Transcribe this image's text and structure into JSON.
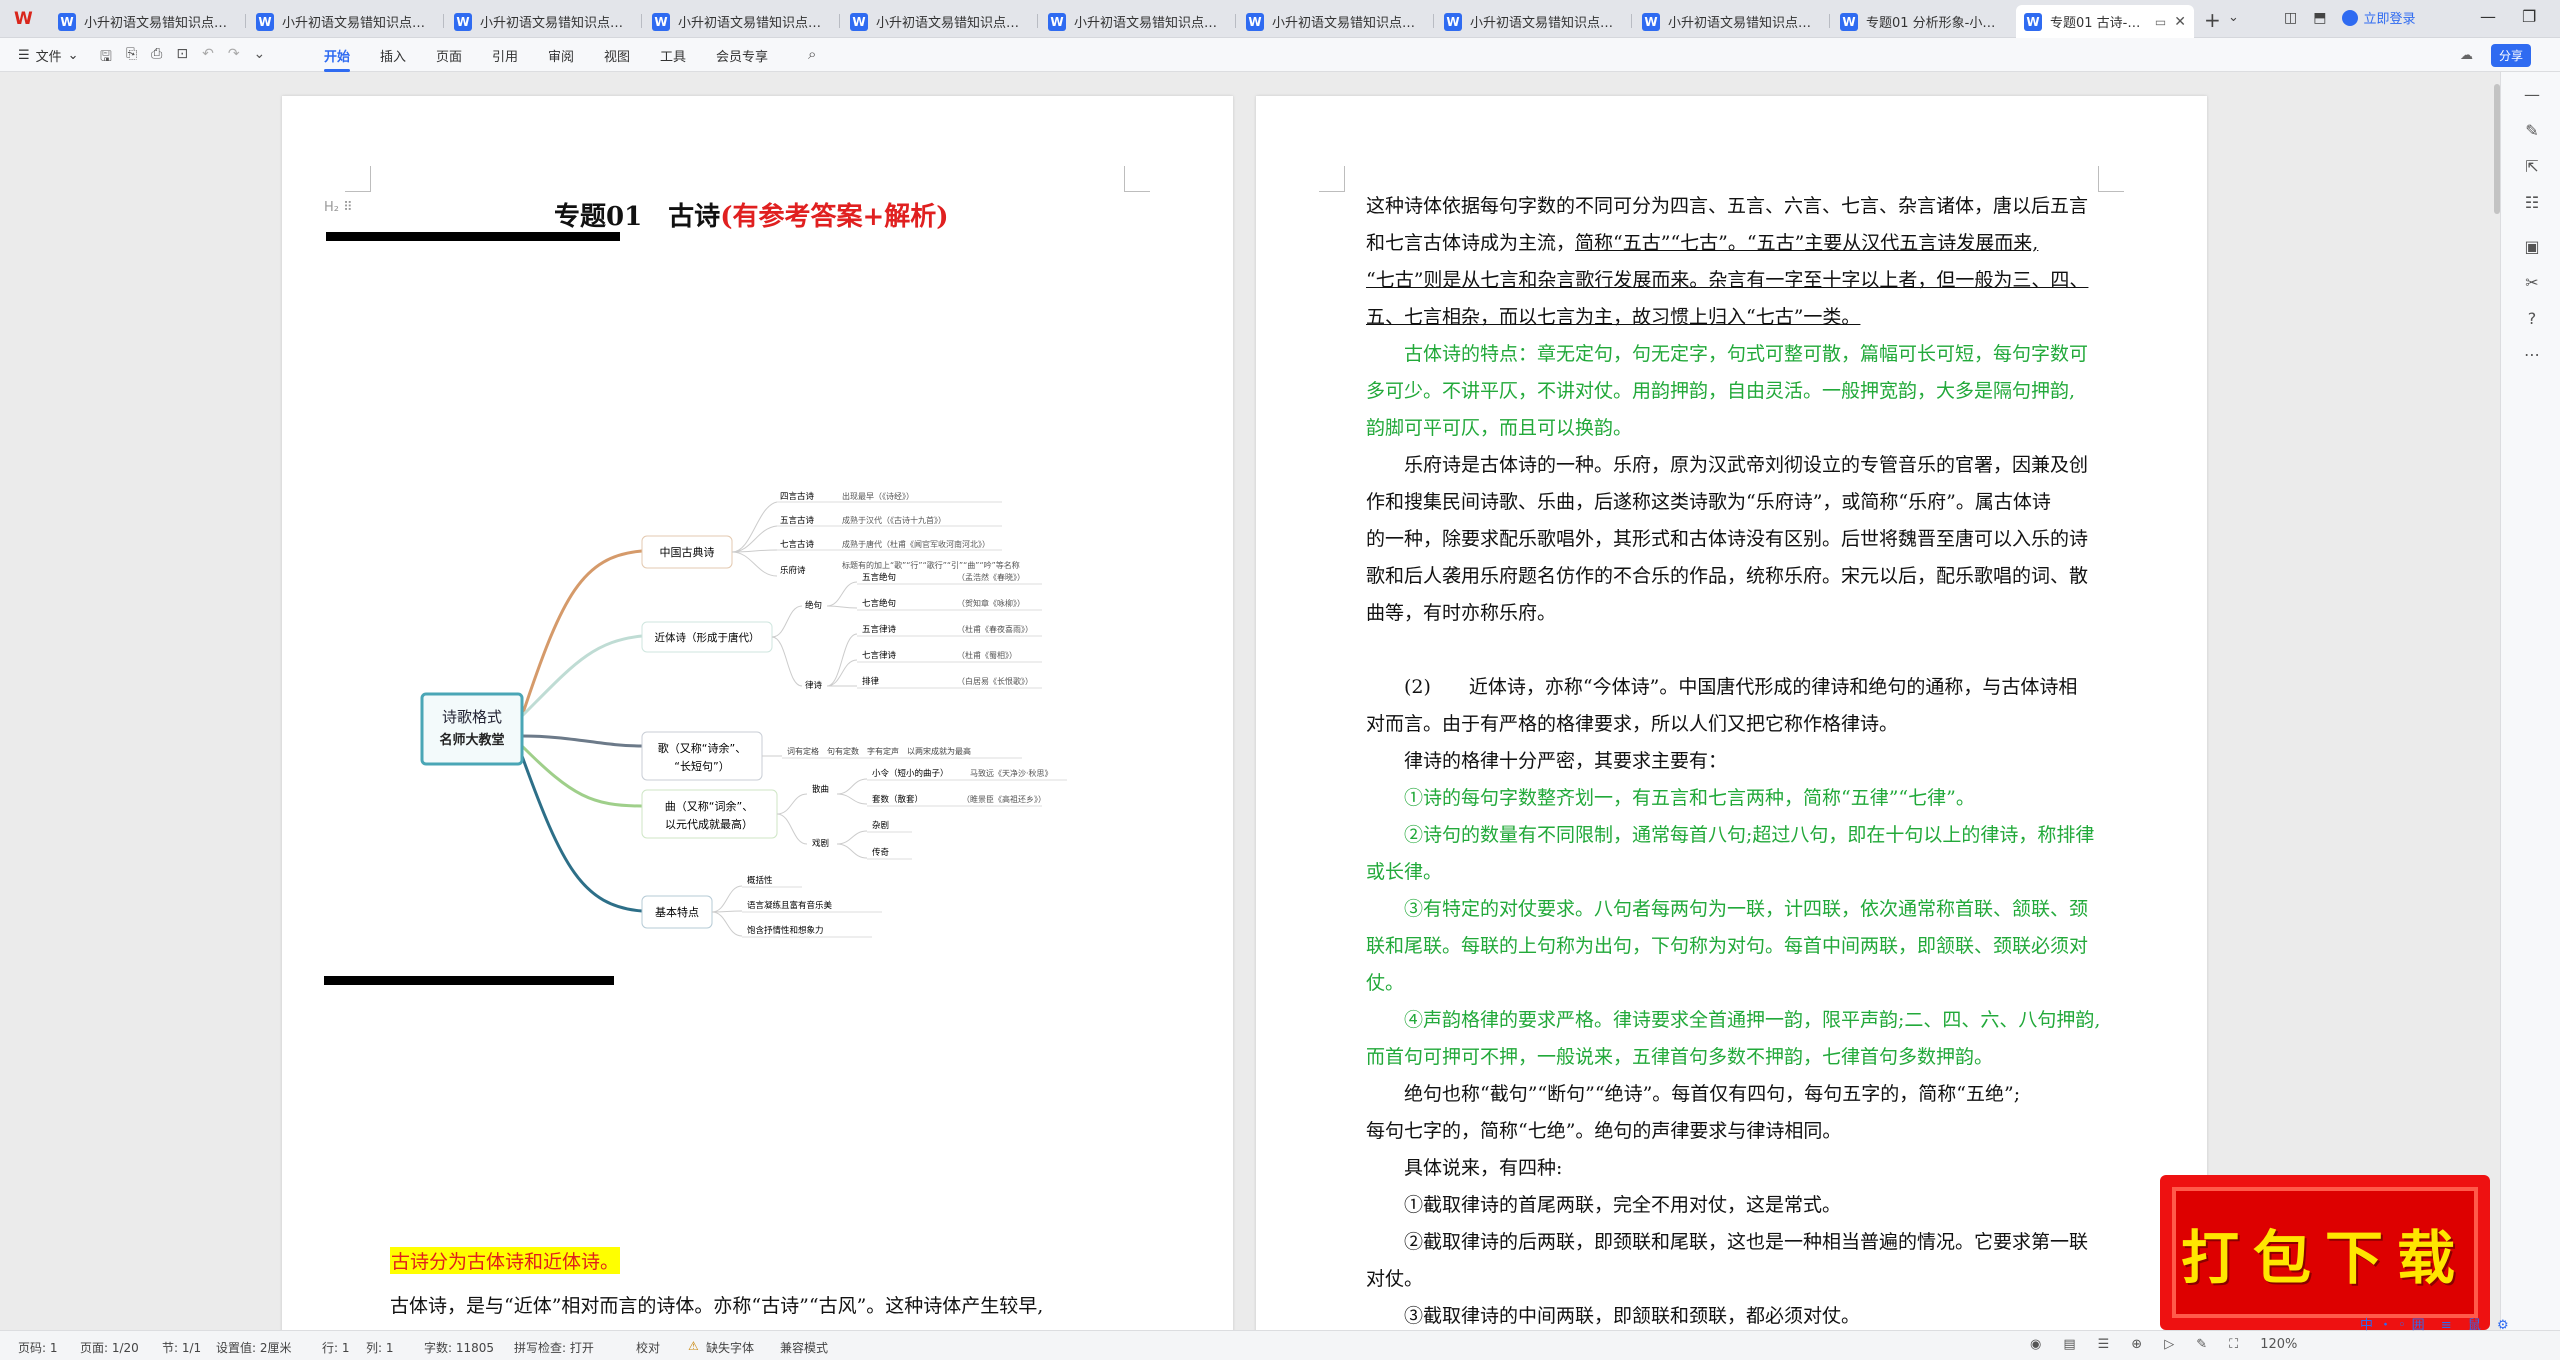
{
  "tabs": [
    {
      "label": "小升初语文易错知识点专项练"
    },
    {
      "label": "小升初语文易错知识点专项练"
    },
    {
      "label": "小升初语文易错知识点专项练"
    },
    {
      "label": "小升初语文易错知识点专项练"
    },
    {
      "label": "小升初语文易错知识点专项练"
    },
    {
      "label": "小升初语文易错知识点专项练"
    },
    {
      "label": "小升初语文易错知识点专项练"
    },
    {
      "label": "小升初语文易错知识点专项练"
    },
    {
      "label": "小升初语文易错知识点专项练"
    },
    {
      "label": "专题01 分析形象-小升初语文"
    },
    {
      "label": "专题01 古诗-小升初语"
    }
  ],
  "header": {
    "login": "立即登录",
    "share": "分享"
  },
  "ribbon": {
    "file": "文件",
    "tabs": [
      "开始",
      "插入",
      "页面",
      "引用",
      "审阅",
      "视图",
      "工具",
      "会员专享"
    ]
  },
  "page1": {
    "title_main": "专题01　古诗",
    "title_red": "(有参考答案+解析)",
    "mindmap": {
      "center_1": "诗歌格式",
      "center_2": "名师大教堂",
      "b1": "中国古典诗",
      "b1_items": [
        "四言古诗",
        "五言古诗",
        "七言古诗",
        "乐府诗"
      ],
      "b1_notes": [
        "出现最早（《诗经》）",
        "成熟于汉代（《古诗十九首》）",
        "成熟于唐代（杜甫《闻官军收河南河北》）",
        "标题有的加上“歌”“行”“歌行”“引”“曲”“吟”等名称"
      ],
      "b2": "近体诗（形成于唐代）",
      "b2_groups": [
        "绝句",
        "律诗"
      ],
      "b2_items": [
        "五言绝句",
        "七言绝句",
        "五言律诗",
        "七言律诗",
        "排律"
      ],
      "b2_notes": [
        "（孟浩然《春晓》）",
        "（贺知章《咏柳》）",
        "（杜甫《春夜喜雨》）",
        "（杜甫《蜀相》）",
        "（白居易《长恨歌》）"
      ],
      "b3_1": "歌（又称“诗余”、",
      "b3_2": "“长短句”）",
      "b3_note": "词有定格　句有定数　字有定声　以两宋成就为最高",
      "b4_1": "曲（又称“词余”、",
      "b4_2": "以元代成就最高）",
      "b4_groups": [
        "散曲",
        "戏剧"
      ],
      "b4_items": [
        "小令（短小的曲子）",
        "套数（散套）",
        "杂剧",
        "传奇"
      ],
      "b4_notes": [
        "马致远《天净沙·秋思》",
        "（睢景臣《高祖还乡》）"
      ],
      "b5": "基本特点",
      "b5_items": [
        "概括性",
        "语言凝练且富有音乐美",
        "饱含抒情性和想象力"
      ]
    },
    "highlight": "古诗分为古体诗和近体诗。",
    "body": "古体诗，是与“近体”相对而言的诗体。亦称“古诗”“古风”。这种诗体产生较早,"
  },
  "page2": {
    "lines": [
      {
        "t": "这种诗体依据每句字数的不同可分为四言、五言、六言、七言、杂言诸体，唐以后五言",
        "c": ""
      },
      {
        "t": "和七言古体诗成为主流，",
        "u": "简称“五古”“七古”。“五古”主要从汉代五言诗发展而来,",
        "c": ""
      },
      {
        "t": "",
        "u": "“七古”则是从七言和杂言歌行发展而来。杂言有一字至十字以上者，但一般为三、四、",
        "c": ""
      },
      {
        "t": "",
        "u": "五、七言相杂，而以七言为主，故习惯上归入“七古”一类。",
        "c": ""
      },
      {
        "t": "古体诗的特点：章无定句，句无定字，句式可整可散，篇幅可长可短，每句字数可",
        "c": "green",
        "ind": true
      },
      {
        "t": "多可少。不讲平仄，不讲对仗。用韵押韵，自由灵活。一般押宽韵，大多是隔句押韵,",
        "c": "green"
      },
      {
        "t": "韵脚可平可仄，而且可以换韵。",
        "c": "green"
      },
      {
        "t": "乐府诗是古体诗的一种。乐府，原为汉武帝刘彻设立的专管音乐的官署，因兼及创",
        "c": "",
        "ind": true
      },
      {
        "t": "作和搜集民间诗歌、乐曲，后遂称这类诗歌为“乐府诗”，或简称“乐府”。属古体诗",
        "c": ""
      },
      {
        "t": "的一种，除要求配乐歌唱外，其形式和古体诗没有区别。后世将魏晋至唐可以入乐的诗",
        "c": ""
      },
      {
        "t": "歌和后人袭用乐府题名仿作的不合乐的作品，统称乐府。宋元以后，配乐歌唱的词、散",
        "c": ""
      },
      {
        "t": "曲等，有时亦称乐府。",
        "c": ""
      },
      {
        "t": "",
        "c": "gap"
      },
      {
        "t": "(2)　　近体诗，亦称“今体诗”。中国唐代形成的律诗和绝句的通称，与古体诗相",
        "c": "",
        "ind": true
      },
      {
        "t": "对而言。由于有严格的格律要求，所以人们又把它称作格律诗。",
        "c": ""
      },
      {
        "t": "律诗的格律十分严密，其要求主要有：",
        "c": "",
        "ind": true
      },
      {
        "t": "①诗的每句字数整齐划一，有五言和七言两种，简称“五律”“七律”。",
        "c": "green",
        "ind": true
      },
      {
        "t": "②诗句的数量有不同限制，通常每首八句;超过八句，即在十句以上的律诗，称排律",
        "c": "green",
        "ind": true
      },
      {
        "t": "或长律。",
        "c": "green"
      },
      {
        "t": "③有特定的对仗要求。八句者每两句为一联，计四联，依次通常称首联、颔联、颈",
        "c": "green",
        "ind": true
      },
      {
        "t": "联和尾联。每联的上句称为出句，下句称为对句。每首中间两联，即颔联、颈联必须对",
        "c": "green"
      },
      {
        "t": "仗。",
        "c": "green"
      },
      {
        "t": "④声韵格律的要求严格。律诗要求全首通押一韵，限平声韵;二、四、六、八句押韵,",
        "c": "green",
        "ind": true
      },
      {
        "t": "而首句可押可不押，一般说来，五律首句多数不押韵，七律首句多数押韵。",
        "c": "green"
      },
      {
        "t": "绝句也称“截句”“断句”“绝诗”。每首仅有四句，每句五字的，简称“五绝”;",
        "c": "",
        "ind": true
      },
      {
        "t": "每句七字的，简称“七绝”。绝句的声律要求与律诗相同。",
        "c": ""
      },
      {
        "t": "具体说来，有四种:",
        "c": "",
        "ind": true
      },
      {
        "t": "①截取律诗的首尾两联，完全不用对仗，这是常式。",
        "c": "",
        "ind": true
      },
      {
        "t": "②截取律诗的后两联，即颈联和尾联，这也是一种相当普遍的情况。它要求第一联",
        "c": "",
        "ind": true
      },
      {
        "t": "对仗。",
        "c": ""
      },
      {
        "t": "③截取律诗的中间两联，即颔联和颈联，都必须对仗。",
        "c": "",
        "ind": true
      }
    ]
  },
  "promo": "打包下载",
  "status": {
    "page": "页码: 1",
    "pages": "页面: 1/20",
    "section": "节: 1/1",
    "setting": "设置值: 2厘米",
    "row": "行: 1",
    "col": "列: 1",
    "words": "字数: 11805",
    "spell": "拼写检查: 打开",
    "proof": "校对",
    "font_missing": "缺失字体",
    "compat": "兼容模式",
    "zoom": "120%"
  },
  "ime": "中・◦囲 ≡ 鼠 ⚙"
}
